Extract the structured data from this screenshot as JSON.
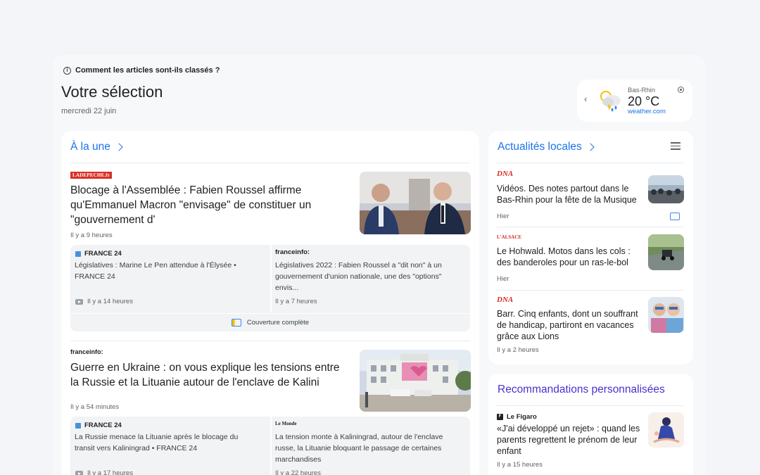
{
  "header": {
    "ranking_link": "Comment les articles sont-ils classés ?",
    "title": "Votre sélection",
    "date": "mercredi 22 juin"
  },
  "weather": {
    "location": "Bas-Rhin",
    "temperature": "20 °C",
    "source": "weather.com"
  },
  "top_stories": {
    "section_title": "À la une",
    "coverage_label": "Couverture complète",
    "stories": [
      {
        "source": "LADEPECHE.fr",
        "headline": "Blocage à l'Assemblée : Fabien Roussel affirme qu'Emmanuel Macron \"envisage\" de constituer un \"gouvernement d'",
        "time": "Il y a 9 heures",
        "related": [
          {
            "source": "FRANCE 24",
            "text": "Législatives : Marine Le Pen attendue à l'Élysée • FRANCE 24",
            "time": "Il y a 14 heures"
          },
          {
            "source": "franceinfo:",
            "text": "Législatives 2022 : Fabien Roussel a \"dit non\" à un gouvernement d'union nationale, une des \"options\" envis...",
            "time": "Il y a 7 heures"
          }
        ]
      },
      {
        "source": "franceinfo:",
        "headline": "Guerre en Ukraine : on vous explique les tensions entre la Russie et la Lituanie autour de l'enclave de Kalini",
        "time": "Il y a 54 minutes",
        "related": [
          {
            "source": "FRANCE 24",
            "text": "La Russie menace la Lituanie après le blocage du transit vers Kaliningrad • FRANCE 24",
            "time": "Il y a 17 heures"
          },
          {
            "source": "Le Monde",
            "text": "La tension monte à Kaliningrad, autour de l'enclave russe, la Lituanie bloquant le passage de certaines marchandises",
            "time": "Il y a 22 heures"
          }
        ]
      }
    ]
  },
  "local": {
    "section_title": "Actualités locales",
    "items": [
      {
        "source": "DNA",
        "text": "Vidéos. Des notes partout dans le Bas-Rhin pour la fête de la Musique",
        "time": "Hier"
      },
      {
        "source": "L'ALSACE",
        "text": "Le Hohwald. Motos dans les cols : des banderoles pour un ras-le-bol",
        "time": "Hier"
      },
      {
        "source": "DNA",
        "text": "Barr. Cinq enfants, dont un souffrant de handicap, partiront en vacances grâce aux Lions",
        "time": "Il y a 2 heures"
      }
    ]
  },
  "recommendations": {
    "section_title": "Recommandations personnalisées",
    "items": [
      {
        "source": "Le Figaro",
        "text": "«J'ai développé un rejet» : quand les parents regrettent le prénom de leur enfant",
        "time": "Il y a 15 heures"
      }
    ]
  },
  "colors": {
    "accent_blue": "#1a73e8",
    "accent_purple": "#4c2fd1",
    "source_red": "#d93025"
  }
}
